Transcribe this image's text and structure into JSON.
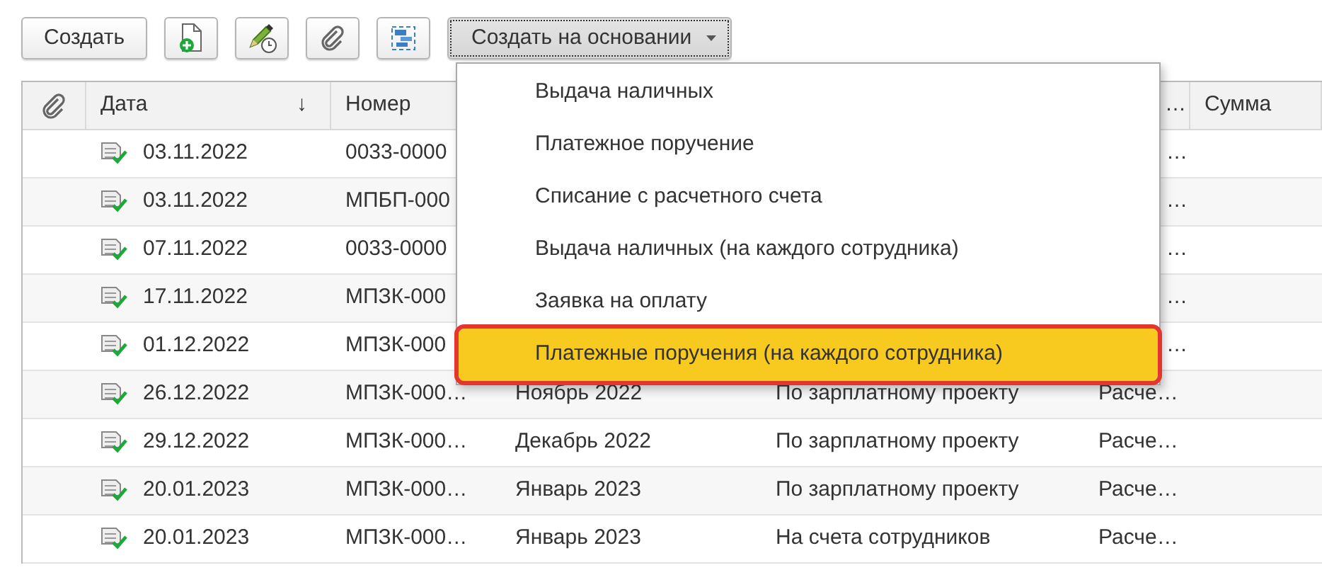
{
  "toolbar": [
    {
      "kind": "text",
      "label": "Создать"
    },
    {
      "kind": "new-doc"
    },
    {
      "kind": "edit-clock"
    },
    {
      "kind": "clip"
    },
    {
      "kind": "structure"
    },
    {
      "kind": "dropdown",
      "label": "Создать на основании",
      "pressed": true
    }
  ],
  "table": {
    "columns": [
      {
        "kind": "clip"
      },
      {
        "label": "Дата",
        "sort": "↓"
      },
      {
        "label": "Номер"
      },
      {},
      {},
      {
        "kind": "cut",
        "label": "…"
      },
      {
        "label": "Сумма"
      }
    ],
    "rows": [
      {
        "posted": true,
        "date": "03.11.2022",
        "number": "0033-0000",
        "col_4": "…"
      },
      {
        "posted": true,
        "date": "03.11.2022",
        "number": "МПБП-000",
        "col_4": "…"
      },
      {
        "posted": true,
        "date": "07.11.2022",
        "number": "0033-0000",
        "col_4": "…"
      },
      {
        "posted": true,
        "date": "17.11.2022",
        "number": "МПЗК-000",
        "col_4": "…"
      },
      {
        "posted": true,
        "date": "01.12.2022",
        "number": "МПЗК-000",
        "col_4": "…"
      },
      {
        "posted": true,
        "date": "26.12.2022",
        "number": "МПЗК-000…",
        "period": "Ноябрь 2022",
        "kind": "По зарплатному проекту",
        "col_4": "Расче…"
      },
      {
        "posted": true,
        "date": "29.12.2022",
        "number": "МПЗК-000…",
        "period": "Декабрь 2022",
        "kind": "По зарплатному проекту",
        "col_4": "Расче…"
      },
      {
        "posted": true,
        "date": "20.01.2023",
        "number": "МПЗК-000…",
        "period": "Январь 2023",
        "kind": "По зарплатному проекту",
        "col_4": "Расче…"
      },
      {
        "posted": true,
        "date": "20.01.2023",
        "number": "МПЗК-000…",
        "period": "Январь 2023",
        "kind": "На счета сотрудников",
        "col_4": "Расче…"
      }
    ]
  },
  "menu": {
    "items": [
      {
        "label": "Выдача наличных",
        "selected": false
      },
      {
        "label": "Платежное поручение",
        "selected": false
      },
      {
        "label": "Списание с расчетного счета",
        "selected": false
      },
      {
        "label": "Выдача наличных (на каждого сотрудника)",
        "selected": false
      },
      {
        "label": "Заявка на оплату",
        "selected": false
      },
      {
        "label": "Платежные поручения (на каждого сотрудника)",
        "selected": true,
        "outlined": true
      }
    ]
  }
}
